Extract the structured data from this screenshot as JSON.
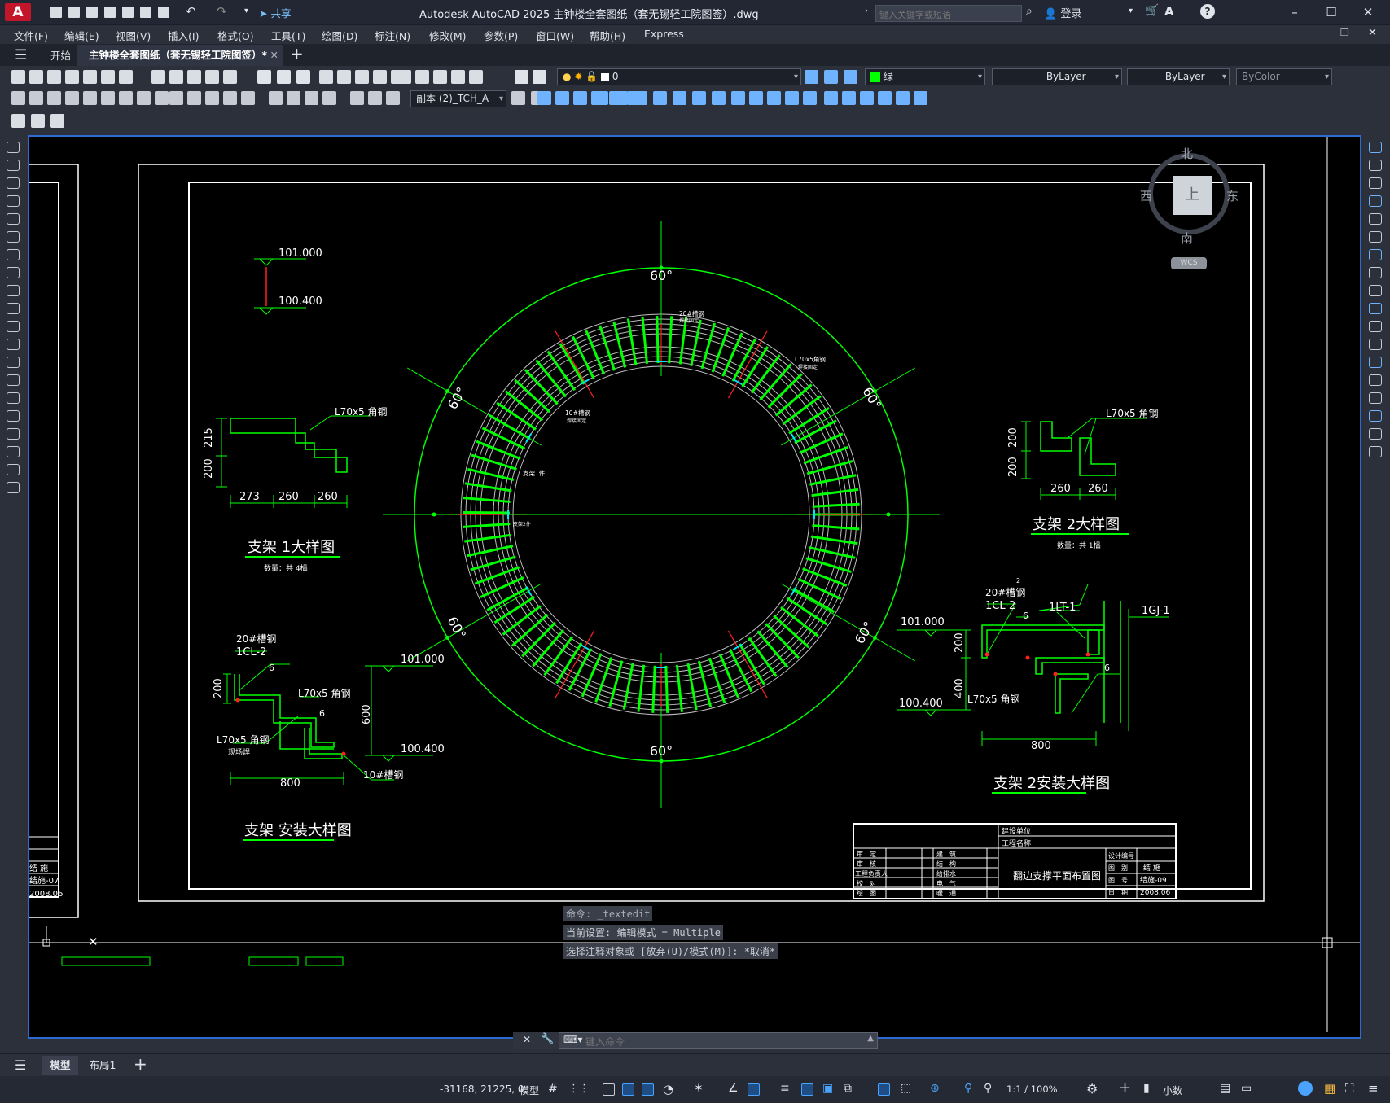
{
  "app": {
    "title": "Autodesk AutoCAD 2025    主钟楼全套图纸（套无锡轻工院图签）.dwg",
    "logo": "A",
    "search_placeholder": "键入关键字或短语",
    "share_label": "共享",
    "login_label": "登录"
  },
  "menu": [
    "文件(F)",
    "编辑(E)",
    "视图(V)",
    "插入(I)",
    "格式(O)",
    "工具(T)",
    "绘图(D)",
    "标注(N)",
    "修改(M)",
    "参数(P)",
    "窗口(W)",
    "帮助(H)",
    "Express"
  ],
  "tabs": {
    "start": "开始",
    "document": "主钟楼全套图纸（套无锡轻工院图签）*"
  },
  "layer_combo": {
    "value": "0"
  },
  "color_combo": {
    "value": "绿",
    "swatch": "#00ff00"
  },
  "linetype_combo": {
    "value": "ByLayer"
  },
  "lineweight_combo": {
    "value": "ByLayer"
  },
  "plotstyle_combo": {
    "value": "ByColor"
  },
  "textstyle_combo": {
    "value": "副本 (2)_TCH_A"
  },
  "viewcube": {
    "north": "北",
    "south": "南",
    "east": "东",
    "west": "西",
    "top": "上",
    "wcs": "WCS"
  },
  "drawing": {
    "angle_label": "60°",
    "ring_labels": [
      "20#槽钢",
      "焊接固定",
      "L70x5角钢",
      "焊接固定",
      "10#槽钢",
      "焊接固定",
      "支架1件",
      "支架2件"
    ],
    "elev_top": "101.000",
    "elev_bottom": "100.400",
    "d1": {
      "dim_215": "215",
      "dim_200": "200",
      "label_angle": "L70x5 角钢",
      "dims_bottom": [
        "273",
        "260",
        "260"
      ],
      "title": "支架 1大样图",
      "count": "数量：共 4榀"
    },
    "d2": {
      "dim_200a": "200",
      "dim_200b": "200",
      "label_angle": "L70x5 角钢",
      "dims_bottom": [
        "260",
        "260"
      ],
      "title": "支架 2大样图",
      "count": "数量：共 1榀"
    },
    "d3": {
      "label_channel": "20#槽钢",
      "label_cl": "1CL-2",
      "weld": "6",
      "dim_200": "200",
      "label_angle1": "L70x5 角钢",
      "weld2": "6",
      "dim_600": "600",
      "label_angle2": "L70x5 角钢",
      "label_site": "现场焊",
      "elev_top": "101.000",
      "elev_bottom": "100.400",
      "label_ch10": "10#槽钢",
      "dim_800": "800",
      "title": "支架 安装大样图"
    },
    "d4": {
      "label_channel": "20#槽钢",
      "label_cl": "1CL-2",
      "weld": "6",
      "label_lt": "1LT-1",
      "label_gj": "1GJ-1",
      "elev_top": "101.000",
      "elev_bottom": "100.400",
      "dim_200": "200",
      "dim_400": "400",
      "label_angle": "L70x5 角钢",
      "weld2": "6",
      "dim_800": "800",
      "title": "支架 2安装大样图",
      "mark": "2"
    },
    "titleblock": {
      "unit": "建设单位",
      "project": "工程名称",
      "roles_left": [
        "审　定",
        "审　核",
        "工程负责人",
        "校　对",
        "绘　图"
      ],
      "disciplines": [
        "建　筑",
        "结　构",
        "给排水",
        "电　气",
        "暖　通"
      ],
      "drawing_name": "翻边支撑平面布置图",
      "design_no_label": "设计编号",
      "category_label": "图　别",
      "category_value": "结 施",
      "sheet_label": "图　号",
      "sheet_value": "结施-09",
      "date_label": "日　期",
      "date_value": "2008.06"
    },
    "left_sheet": {
      "category": "结 施",
      "sheet": "结施-07",
      "date": "2008.06"
    }
  },
  "command": {
    "history": [
      "命令: _textedit",
      "当前设置: 编辑模式 = Multiple",
      "选择注释对象或 [放弃(U)/模式(M)]: *取消*"
    ],
    "placeholder": "键入命令"
  },
  "layouts": [
    "模型",
    "布局1"
  ],
  "status": {
    "coords": "-31168, 21225, 0",
    "model": "模型",
    "scale": "1:1 / 100%",
    "units": "小数"
  }
}
